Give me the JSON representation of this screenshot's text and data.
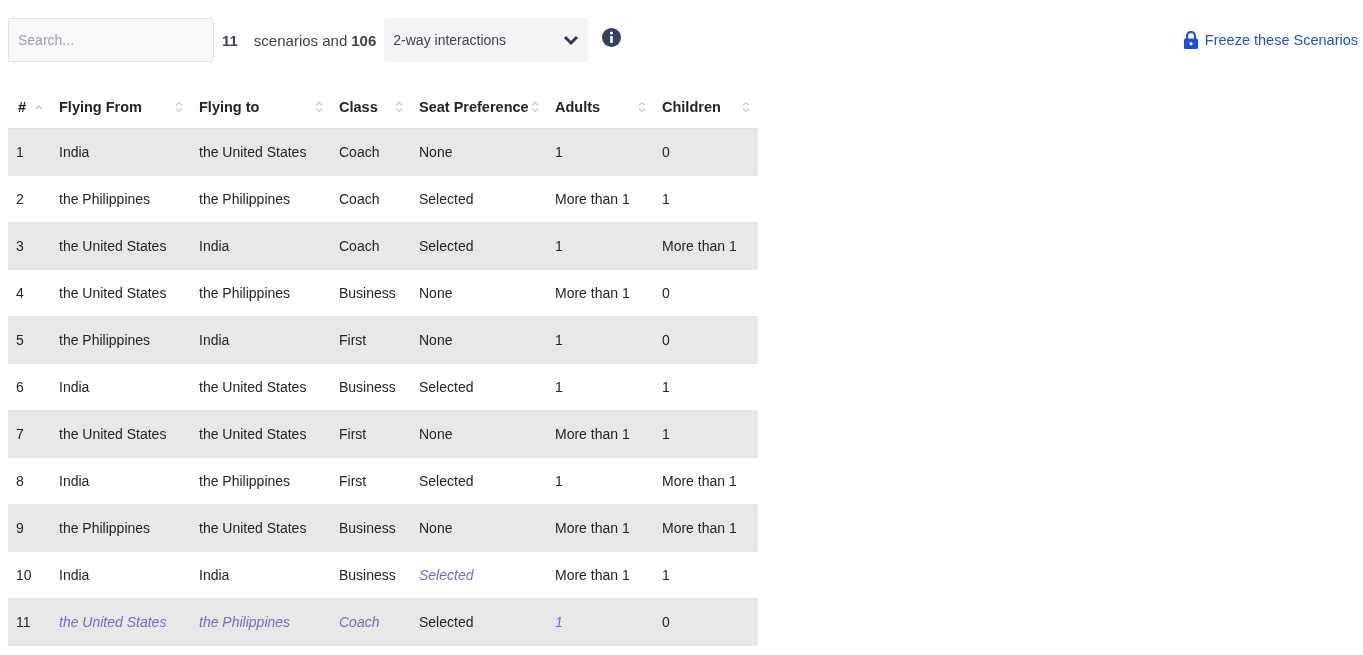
{
  "toolbar": {
    "search": {
      "placeholder": "Search..."
    },
    "scenario_count": "11",
    "summary_text": "scenarios and",
    "interaction_count": "106",
    "strength_select": {
      "value": "2-way interactions"
    },
    "freeze_link": "Freeze these Scenarios"
  },
  "table": {
    "columns": [
      {
        "label": "#",
        "sorted": true
      },
      {
        "label": "Flying From",
        "sorted": false
      },
      {
        "label": "Flying to",
        "sorted": false
      },
      {
        "label": "Class",
        "sorted": false
      },
      {
        "label": "Seat Preference",
        "sorted": false
      },
      {
        "label": "Adults",
        "sorted": false
      },
      {
        "label": "Children",
        "sorted": false
      }
    ],
    "rows": [
      {
        "cells": [
          {
            "text": "1",
            "kind": "value"
          },
          {
            "text": "India",
            "kind": "value"
          },
          {
            "text": "the United States",
            "kind": "value"
          },
          {
            "text": "Coach",
            "kind": "value"
          },
          {
            "text": "None",
            "kind": "value"
          },
          {
            "text": "1",
            "kind": "value"
          },
          {
            "text": "0",
            "kind": "value"
          }
        ]
      },
      {
        "cells": [
          {
            "text": "2",
            "kind": "value"
          },
          {
            "text": "the Philippines",
            "kind": "value"
          },
          {
            "text": "the Philippines",
            "kind": "value"
          },
          {
            "text": "Coach",
            "kind": "value"
          },
          {
            "text": "Selected",
            "kind": "value"
          },
          {
            "text": "More than 1",
            "kind": "value"
          },
          {
            "text": "1",
            "kind": "value"
          }
        ]
      },
      {
        "cells": [
          {
            "text": "3",
            "kind": "value"
          },
          {
            "text": "the United States",
            "kind": "value"
          },
          {
            "text": "India",
            "kind": "value"
          },
          {
            "text": "Coach",
            "kind": "value"
          },
          {
            "text": "Selected",
            "kind": "value"
          },
          {
            "text": "1",
            "kind": "value"
          },
          {
            "text": "More than 1",
            "kind": "value"
          }
        ]
      },
      {
        "cells": [
          {
            "text": "4",
            "kind": "value"
          },
          {
            "text": "the United States",
            "kind": "value"
          },
          {
            "text": "the Philippines",
            "kind": "value"
          },
          {
            "text": "Business",
            "kind": "value"
          },
          {
            "text": "None",
            "kind": "value"
          },
          {
            "text": "More than 1",
            "kind": "value"
          },
          {
            "text": "0",
            "kind": "value"
          }
        ]
      },
      {
        "cells": [
          {
            "text": "5",
            "kind": "value"
          },
          {
            "text": "the Philippines",
            "kind": "value"
          },
          {
            "text": "India",
            "kind": "value"
          },
          {
            "text": "First",
            "kind": "value"
          },
          {
            "text": "None",
            "kind": "value"
          },
          {
            "text": "1",
            "kind": "value"
          },
          {
            "text": "0",
            "kind": "value"
          }
        ]
      },
      {
        "cells": [
          {
            "text": "6",
            "kind": "value"
          },
          {
            "text": "India",
            "kind": "value"
          },
          {
            "text": "the United States",
            "kind": "value"
          },
          {
            "text": "Business",
            "kind": "value"
          },
          {
            "text": "Selected",
            "kind": "value"
          },
          {
            "text": "1",
            "kind": "value"
          },
          {
            "text": "1",
            "kind": "value"
          }
        ]
      },
      {
        "cells": [
          {
            "text": "7",
            "kind": "value"
          },
          {
            "text": "the United States",
            "kind": "value"
          },
          {
            "text": "the United States",
            "kind": "value"
          },
          {
            "text": "First",
            "kind": "value"
          },
          {
            "text": "None",
            "kind": "value"
          },
          {
            "text": "More than 1",
            "kind": "value"
          },
          {
            "text": "1",
            "kind": "value"
          }
        ]
      },
      {
        "cells": [
          {
            "text": "8",
            "kind": "value"
          },
          {
            "text": "India",
            "kind": "value"
          },
          {
            "text": "the Philippines",
            "kind": "value"
          },
          {
            "text": "First",
            "kind": "value"
          },
          {
            "text": "Selected",
            "kind": "value"
          },
          {
            "text": "1",
            "kind": "value"
          },
          {
            "text": "More than 1",
            "kind": "value"
          }
        ]
      },
      {
        "cells": [
          {
            "text": "9",
            "kind": "value"
          },
          {
            "text": "the Philippines",
            "kind": "value"
          },
          {
            "text": "the United States",
            "kind": "value"
          },
          {
            "text": "Business",
            "kind": "value"
          },
          {
            "text": "None",
            "kind": "value"
          },
          {
            "text": "More than 1",
            "kind": "value"
          },
          {
            "text": "More than 1",
            "kind": "value"
          }
        ]
      },
      {
        "cells": [
          {
            "text": "10",
            "kind": "value"
          },
          {
            "text": "India",
            "kind": "value"
          },
          {
            "text": "India",
            "kind": "value"
          },
          {
            "text": "Business",
            "kind": "value"
          },
          {
            "text": "Selected",
            "kind": "filler"
          },
          {
            "text": "More than 1",
            "kind": "value"
          },
          {
            "text": "1",
            "kind": "value"
          }
        ]
      },
      {
        "cells": [
          {
            "text": "11",
            "kind": "value"
          },
          {
            "text": "the United States",
            "kind": "filler"
          },
          {
            "text": "the Philippines",
            "kind": "filler"
          },
          {
            "text": "Coach",
            "kind": "filler"
          },
          {
            "text": "Selected",
            "kind": "value"
          },
          {
            "text": "1",
            "kind": "filler"
          },
          {
            "text": "0",
            "kind": "value"
          }
        ]
      }
    ]
  }
}
